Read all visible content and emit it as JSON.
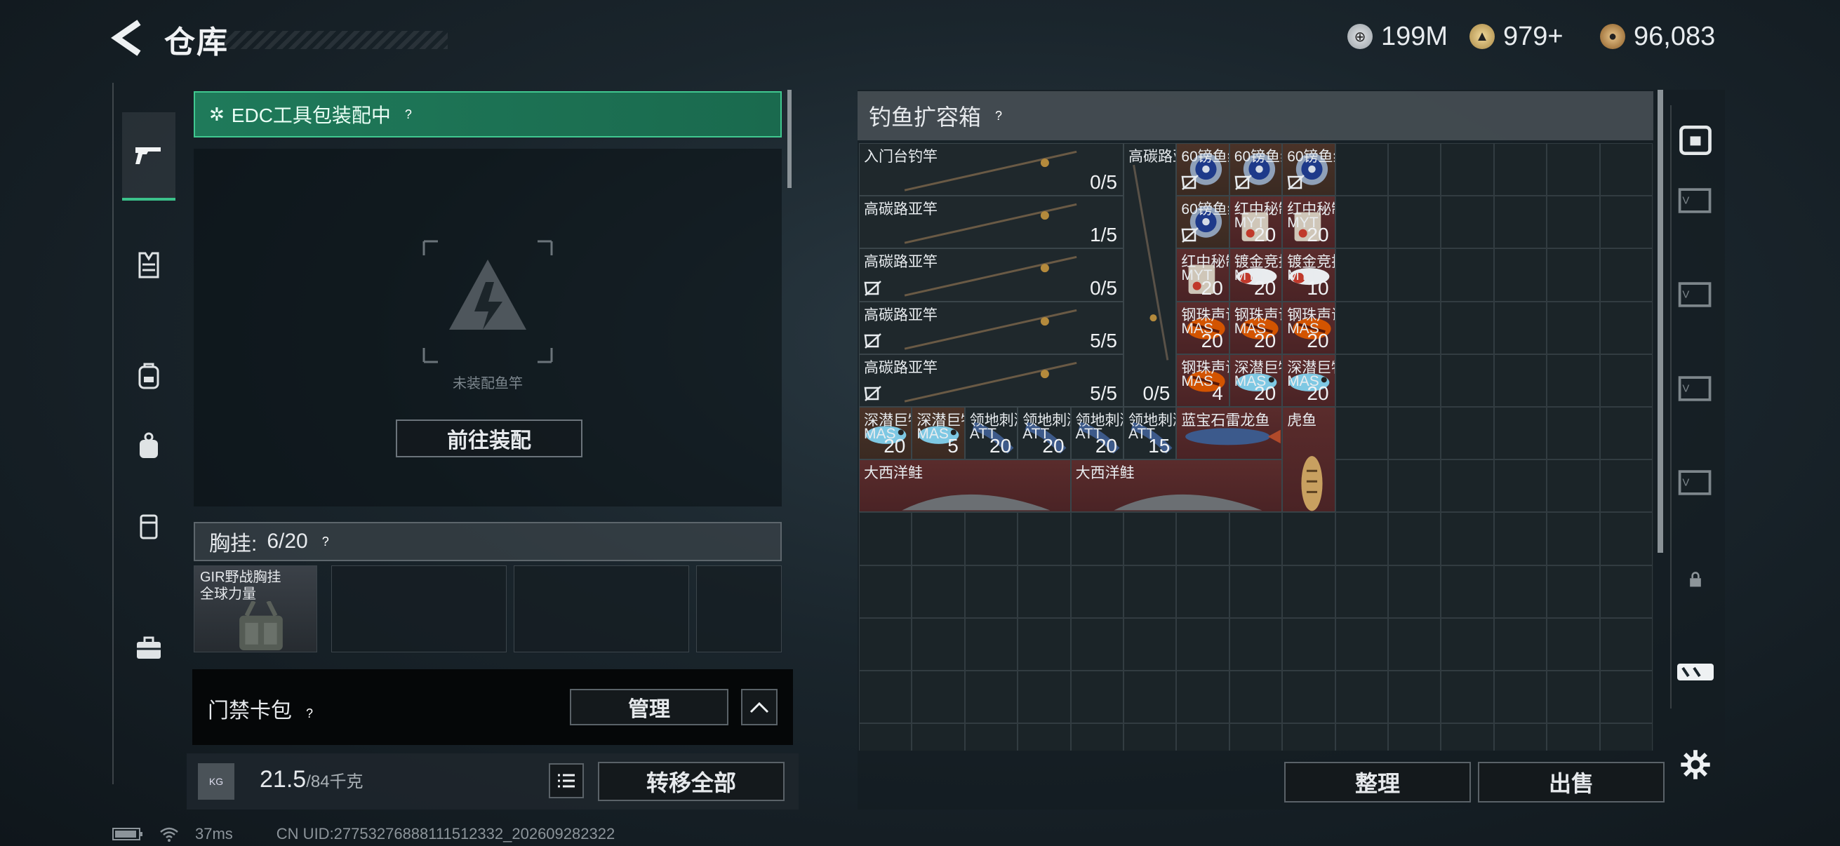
{
  "header": {
    "title": "仓库"
  },
  "currencies": [
    {
      "icon": "silver-coin-icon",
      "value": "199M"
    },
    {
      "icon": "gold-triangle-coin-icon",
      "value": "979+"
    },
    {
      "icon": "bronze-coin-icon",
      "value": "96,083"
    }
  ],
  "left_panel": {
    "edc_banner": "EDC工具包装配中",
    "empty_slot_text": "未装配鱼竿",
    "goto_equip": "前往装配",
    "chest_rig_label": "胸挂:",
    "chest_rig_count": "6/20",
    "chest_item": {
      "name": "GIR野战胸挂",
      "sub": "全球力量"
    },
    "card_bag_label": "门禁卡包",
    "manage": "管理",
    "weight": "21.5",
    "weight_max": "/84千克",
    "transfer_all": "转移全部",
    "kg_label": "KG"
  },
  "container": {
    "title": "钓鱼扩容箱",
    "items": [
      {
        "name": "入门台钓竿",
        "qty": "0/5",
        "color": "dark"
      },
      {
        "name": "高碳路亚竿",
        "qty": "1/5",
        "color": "dark"
      },
      {
        "name": "高碳路亚竿",
        "qty": "0/5",
        "color": "dark"
      },
      {
        "name": "高碳路亚竿",
        "qty": "5/5",
        "color": "dark"
      },
      {
        "name": "高碳路亚竿",
        "qty": "5/5",
        "color": "dark"
      },
      {
        "name": "高碳路亚竿",
        "qty": "0/5",
        "color": "dark"
      },
      {
        "name": "60镑鱼线",
        "qty": "",
        "color": "brown"
      },
      {
        "name": "60镑鱼线",
        "qty": "",
        "color": "brown"
      },
      {
        "name": "60镑鱼线",
        "qty": "",
        "color": "brown"
      },
      {
        "name": "60镑鱼线",
        "qty": "",
        "color": "brown"
      },
      {
        "name": "红中秘制饵",
        "sub": "MYT",
        "qty": "20",
        "color": "maroon"
      },
      {
        "name": "红中秘制饵",
        "sub": "MYT",
        "qty": "20",
        "color": "maroon"
      },
      {
        "name": "红中秘制饵",
        "sub": "MYT",
        "qty": "20",
        "color": "maroon"
      },
      {
        "name": "镀金竞技...",
        "sub": "MYT",
        "qty": "20",
        "color": "maroon"
      },
      {
        "name": "镀金竞技...",
        "sub": "MYT",
        "qty": "10",
        "color": "maroon"
      },
      {
        "name": "钢珠声诱...",
        "sub": "MAS",
        "qty": "20",
        "color": "maroon"
      },
      {
        "name": "钢珠声诱...",
        "sub": "MAS",
        "qty": "20",
        "color": "maroon"
      },
      {
        "name": "钢珠声诱...",
        "sub": "MAS",
        "qty": "20",
        "color": "maroon"
      },
      {
        "name": "钢珠声诱...",
        "sub": "MAS",
        "qty": "4",
        "color": "maroon"
      },
      {
        "name": "深潜巨物...",
        "sub": "MAS",
        "qty": "20",
        "color": "maroon"
      },
      {
        "name": "深潜巨物...",
        "sub": "MAS",
        "qty": "20",
        "color": "maroon"
      },
      {
        "name": "深潜巨物...",
        "sub": "MAS",
        "qty": "20",
        "color": "brown"
      },
      {
        "name": "深潜巨物...",
        "sub": "MAS",
        "qty": "5",
        "color": "brown"
      },
      {
        "name": "领地刺激...",
        "sub": "ATT",
        "qty": "20",
        "color": "dark"
      },
      {
        "name": "领地刺激...",
        "sub": "ATT",
        "qty": "20",
        "color": "dark"
      },
      {
        "name": "领地刺激...",
        "sub": "ATT",
        "qty": "20",
        "color": "dark"
      },
      {
        "name": "领地刺激...",
        "sub": "ATT",
        "qty": "15",
        "color": "dark"
      },
      {
        "name": "蓝宝石雷龙鱼",
        "qty": "",
        "color": "maroon"
      },
      {
        "name": "虎鱼",
        "qty": "",
        "color": "maroon"
      },
      {
        "name": "大西洋鲑",
        "qty": "",
        "color": "maroon"
      },
      {
        "name": "大西洋鲑",
        "qty": "",
        "color": "maroon"
      }
    ],
    "sort": "整理",
    "sell": "出售"
  },
  "status_bar": {
    "ping": "37ms",
    "uid": "CN UID:27753276888111512332_202609282322"
  }
}
